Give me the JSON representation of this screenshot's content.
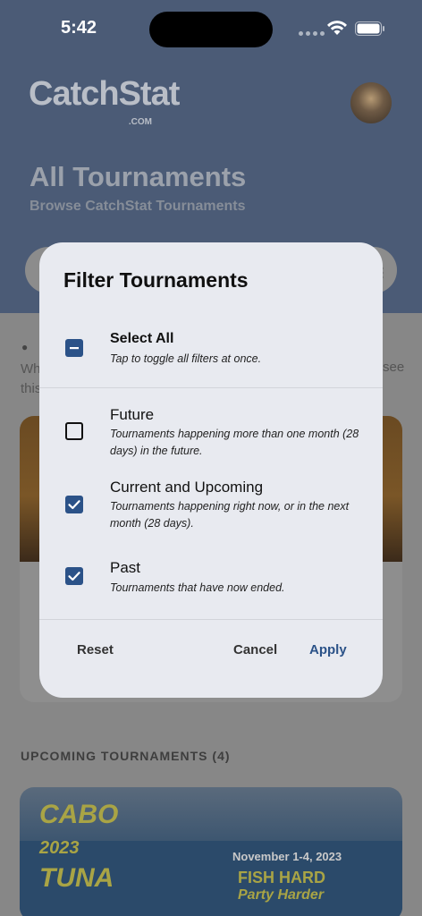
{
  "status_bar": {
    "time": "5:42"
  },
  "header": {
    "logo_text": "CatchStat",
    "logo_suffix": ".COM",
    "title": "All Tournaments",
    "subtitle": "Browse CatchStat Tournaments"
  },
  "intro": {
    "text_left": "Wh",
    "text_left2": "this",
    "text_right": "see"
  },
  "sections": {
    "upcoming_heading": "UPCOMING TOURNAMENTS (4)"
  },
  "upcoming_card": {
    "brand_line1": "CABO",
    "brand_line2": "2023",
    "brand_line3": "TUNA",
    "date": "November 1-4, 2023",
    "tag_line1": "FISH HARD",
    "tag_line2": "Party Harder"
  },
  "modal": {
    "title": "Filter Tournaments",
    "select_all": {
      "label": "Select All",
      "description": "Tap to toggle all filters at once.",
      "state": "indeterminate"
    },
    "filters": [
      {
        "label": "Future",
        "description": "Tournaments happening more than one month (28 days) in the future.",
        "checked": false
      },
      {
        "label": "Current and Upcoming",
        "description": "Tournaments happening right now, or in the next month (28 days).",
        "checked": true
      },
      {
        "label": "Past",
        "description": "Tournaments that have now ended.",
        "checked": true
      }
    ],
    "buttons": {
      "reset": "Reset",
      "cancel": "Cancel",
      "apply": "Apply"
    }
  },
  "colors": {
    "accent": "#2b5288",
    "hero_bg": "#4b5b76",
    "modal_bg": "#e8eaf0"
  }
}
